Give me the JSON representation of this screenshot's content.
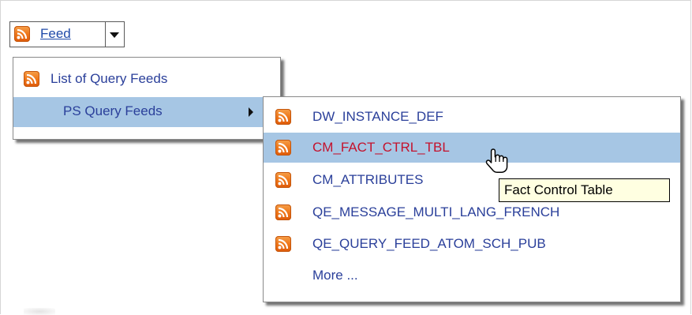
{
  "feed_button": {
    "label": "Feed",
    "icon": "rss-icon",
    "dropdown_icon": "chevron-down-icon"
  },
  "main_menu": {
    "items": [
      {
        "label": "List of Query Feeds",
        "icon": "rss-icon"
      },
      {
        "label": "PS Query Feeds",
        "has_submenu": true
      }
    ]
  },
  "submenu": {
    "items": [
      {
        "label": "DW_INSTANCE_DEF",
        "icon": "rss-icon"
      },
      {
        "label": "CM_FACT_CTRL_TBL",
        "icon": "rss-icon",
        "highlighted": true
      },
      {
        "label": "CM_ATTRIBUTES",
        "icon": "rss-icon"
      },
      {
        "label": "QE_MESSAGE_MULTI_LANG_FRENCH",
        "icon": "rss-icon"
      },
      {
        "label": "QE_QUERY_FEED_ATOM_SCH_PUB",
        "icon": "rss-icon"
      },
      {
        "label": "More ..."
      }
    ]
  },
  "tooltip": {
    "text": "Fact Control Table"
  },
  "colors": {
    "highlight": "#a6c6e4",
    "link": "#1f4aa8",
    "menu_text": "#2a3f9a",
    "hover_text": "#c4122d",
    "rss": "#ee7417",
    "tooltip_bg": "#ffffe1"
  }
}
